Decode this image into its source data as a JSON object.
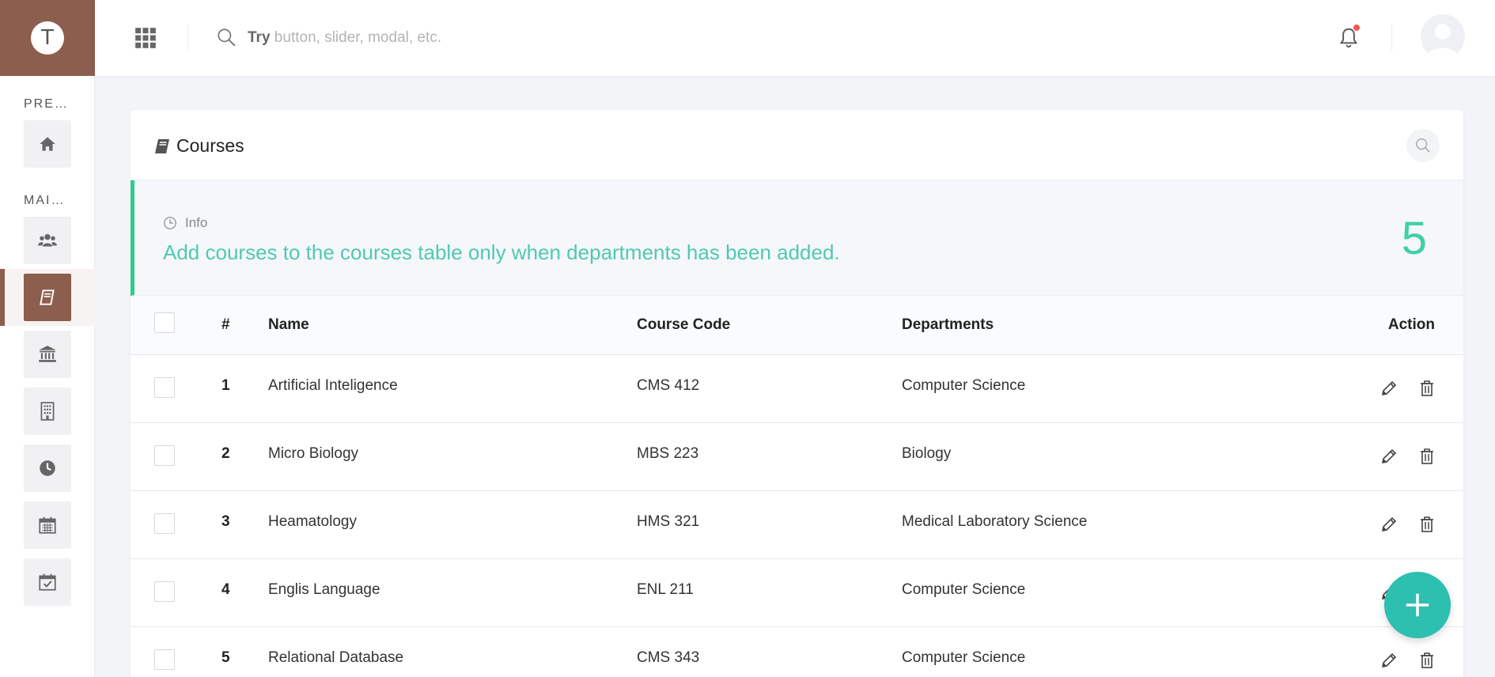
{
  "brand": {
    "initial": "T"
  },
  "sidebar": {
    "sections": [
      {
        "label": "PREVIEW"
      },
      {
        "label": "MAIN MENU"
      }
    ],
    "items": [
      {
        "icon": "home-icon"
      },
      {
        "icon": "users-icon"
      },
      {
        "icon": "book-icon",
        "active": true
      },
      {
        "icon": "institution-icon"
      },
      {
        "icon": "building-icon"
      },
      {
        "icon": "clock-icon"
      },
      {
        "icon": "calendar-icon"
      },
      {
        "icon": "calendar-check-icon"
      }
    ]
  },
  "topbar": {
    "search_hint_bold": "Try",
    "search_hint_rest": " button, slider, modal, etc.",
    "search_value": ""
  },
  "card": {
    "title": "Courses",
    "info_label": "Info",
    "info_text": "Add courses to the courses table only when departments has been added.",
    "info_count": "5"
  },
  "table": {
    "headers": {
      "num": "#",
      "name": "Name",
      "code": "Course Code",
      "dept": "Departments",
      "action": "Action"
    },
    "rows": [
      {
        "num": "1",
        "name": "Artificial Inteligence",
        "code": "CMS 412",
        "dept": "Computer Science"
      },
      {
        "num": "2",
        "name": "Micro Biology",
        "code": "MBS 223",
        "dept": "Biology"
      },
      {
        "num": "3",
        "name": "Heamatology",
        "code": "HMS 321",
        "dept": "Medical Laboratory Science"
      },
      {
        "num": "4",
        "name": "Englis Language",
        "code": "ENL 211",
        "dept": "Computer Science"
      },
      {
        "num": "5",
        "name": "Relational Database",
        "code": "CMS 343",
        "dept": "Computer Science"
      }
    ]
  },
  "colors": {
    "brand": "#8c5e4e",
    "accent": "#2dbfb0",
    "info_green": "#2ecc8f",
    "notification_dot": "#f05a4f"
  }
}
